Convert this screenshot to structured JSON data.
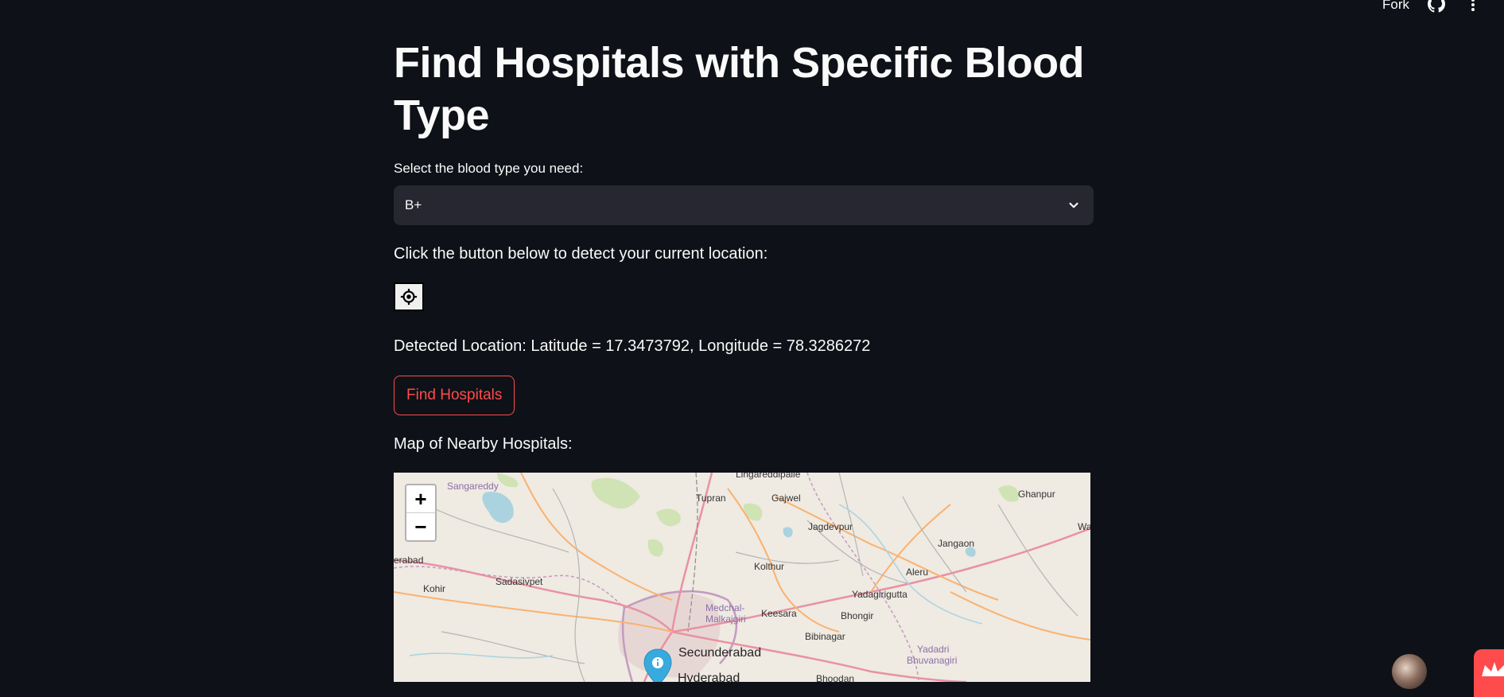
{
  "topbar": {
    "fork_label": "Fork"
  },
  "page": {
    "title": "Find Hospitals with Specific Blood Type",
    "select_label": "Select the blood type you need:",
    "selected_blood_type": "B+",
    "instruction": "Click the button below to detect your current location:",
    "detected_location": "Detected Location: Latitude = 17.3473792, Longitude = 78.3286272",
    "find_button_label": "Find Hospitals",
    "map_label": "Map of Nearby Hospitals:"
  },
  "map": {
    "zoom_in": "+",
    "zoom_out": "−",
    "places": [
      {
        "name": "Lingareddipalle",
        "style": "normal"
      },
      {
        "name": "Sangareddy",
        "style": "purple"
      },
      {
        "name": "Tupran",
        "style": "normal"
      },
      {
        "name": "Gajwel",
        "style": "normal"
      },
      {
        "name": "Ghanpur",
        "style": "normal"
      },
      {
        "name": "Jagdevpur",
        "style": "normal"
      },
      {
        "name": "Wa",
        "style": "normal"
      },
      {
        "name": "erabad",
        "style": "normal"
      },
      {
        "name": "Jangaon",
        "style": "normal"
      },
      {
        "name": "Kolthur",
        "style": "normal"
      },
      {
        "name": "Sadasivpet",
        "style": "normal"
      },
      {
        "name": "Aleru",
        "style": "normal"
      },
      {
        "name": "Kohir",
        "style": "normal"
      },
      {
        "name": "Yadagirigutta",
        "style": "normal"
      },
      {
        "name": "Medchal-",
        "style": "purple"
      },
      {
        "name": "Malkajgiri",
        "style": "purple"
      },
      {
        "name": "Keesara",
        "style": "normal"
      },
      {
        "name": "Bhongir",
        "style": "normal"
      },
      {
        "name": "Bibinagar",
        "style": "normal"
      },
      {
        "name": "Yadadri",
        "style": "purple"
      },
      {
        "name": "Bhuvanagiri",
        "style": "purple"
      },
      {
        "name": "Secunderabad",
        "style": "big"
      },
      {
        "name": "Hyderabad",
        "style": "big"
      },
      {
        "name": "Bhoodan",
        "style": "normal"
      }
    ]
  },
  "icons": {
    "github": "github-icon",
    "menu": "kebab-menu-icon",
    "chevron": "chevron-down-icon",
    "locate": "crosshair-locate-icon",
    "marker": "map-marker-info-icon"
  },
  "colors": {
    "background": "#0e1117",
    "select_bg": "#262730",
    "accent": "#ff4b4b",
    "marker": "#38aadd"
  }
}
